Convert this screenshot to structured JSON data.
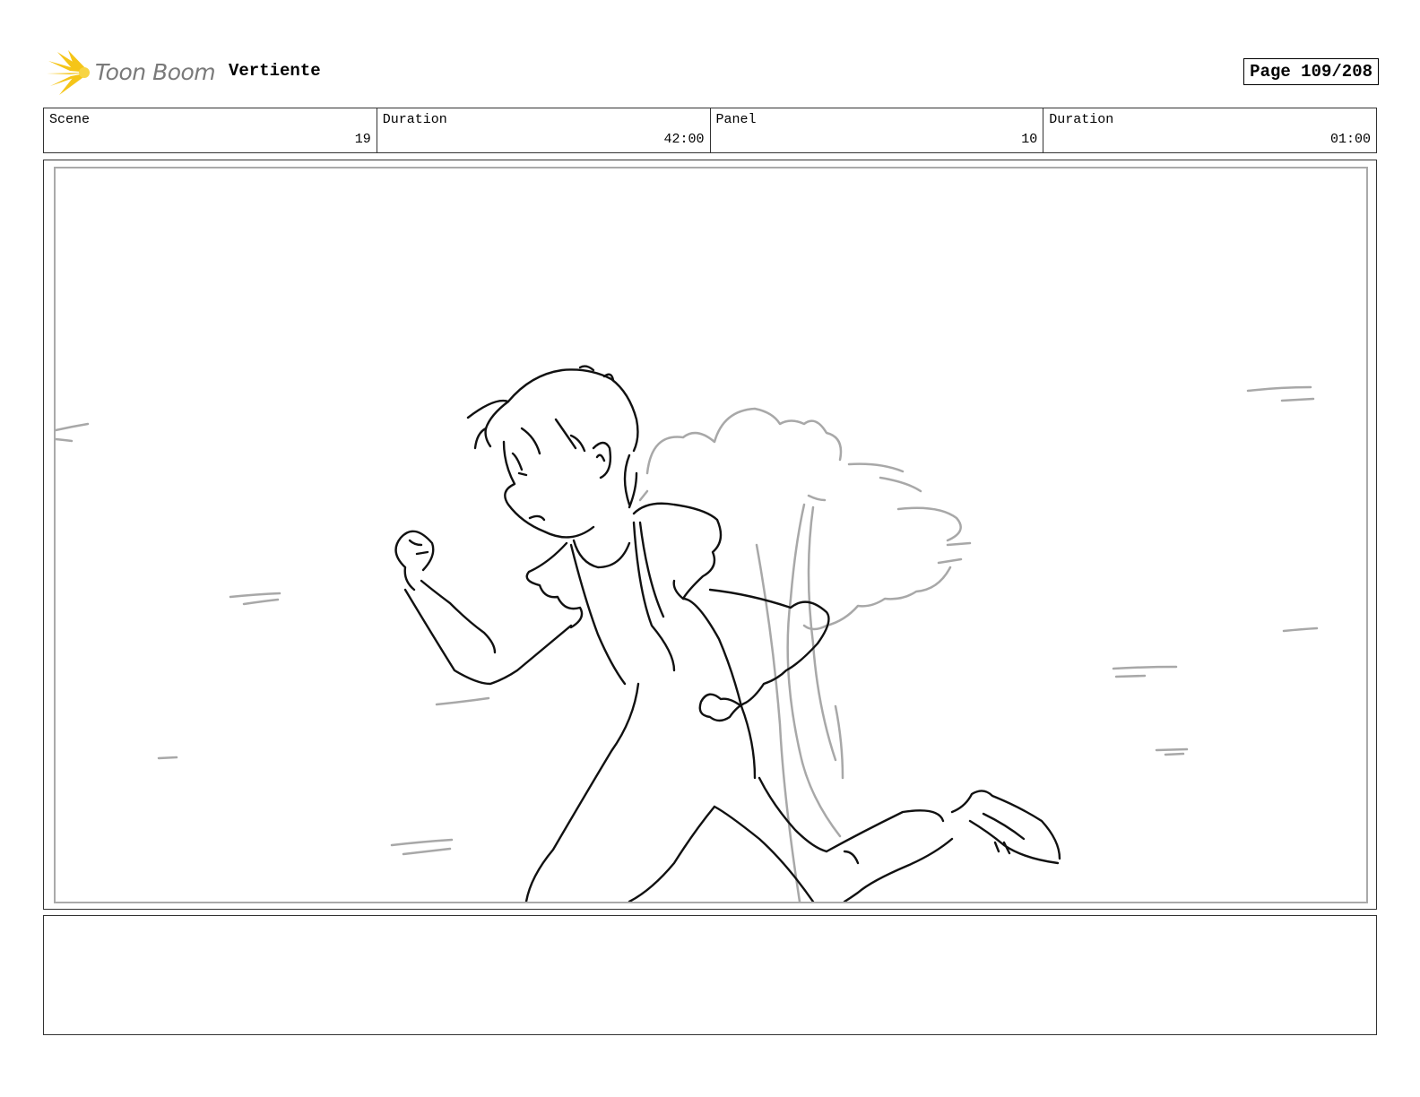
{
  "header": {
    "logo_text": "Toon Boom",
    "project_title": "Vertiente",
    "page_label": "Page 109/208"
  },
  "info": [
    {
      "label": "Scene",
      "value": "19"
    },
    {
      "label": "Duration",
      "value": "42:00"
    },
    {
      "label": "Panel",
      "value": "10"
    },
    {
      "label": "Duration",
      "value": "01:00"
    }
  ],
  "colors": {
    "logo_yellow": "#f5c518",
    "sketch_line": "#111111",
    "rough_line": "#a8a8a8"
  },
  "icons": {
    "logo": "starburst-icon"
  }
}
